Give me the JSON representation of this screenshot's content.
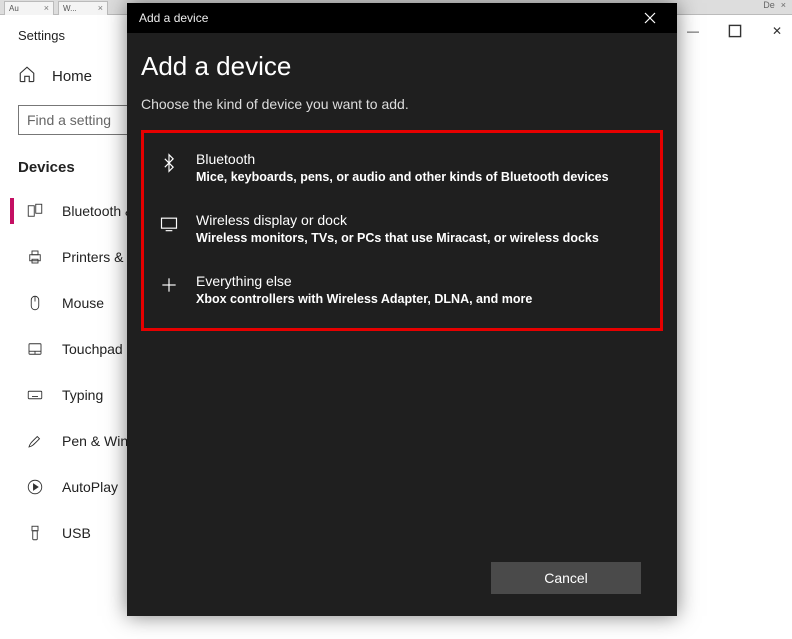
{
  "browser": {
    "tabs": [
      "Au",
      "W..."
    ],
    "right_label": "De"
  },
  "settings": {
    "title": "Settings",
    "home": "Home",
    "search_placeholder": "Find a setting",
    "section": "Devices",
    "nav": [
      {
        "label": "Bluetooth & ..."
      },
      {
        "label": "Printers & sc..."
      },
      {
        "label": "Mouse"
      },
      {
        "label": "Touchpad"
      },
      {
        "label": "Typing"
      },
      {
        "label": "Pen & Wind..."
      },
      {
        "label": "AutoPlay"
      },
      {
        "label": "USB"
      }
    ]
  },
  "dialog": {
    "titlebar": "Add a device",
    "heading": "Add a device",
    "subtitle": "Choose the kind of device you want to add.",
    "options": [
      {
        "title": "Bluetooth",
        "desc": "Mice, keyboards, pens, or audio and other kinds of Bluetooth devices"
      },
      {
        "title": "Wireless display or dock",
        "desc": "Wireless monitors, TVs, or PCs that use Miracast, or wireless docks"
      },
      {
        "title": "Everything else",
        "desc": "Xbox controllers with Wireless Adapter, DLNA, and more"
      }
    ],
    "cancel": "Cancel"
  }
}
